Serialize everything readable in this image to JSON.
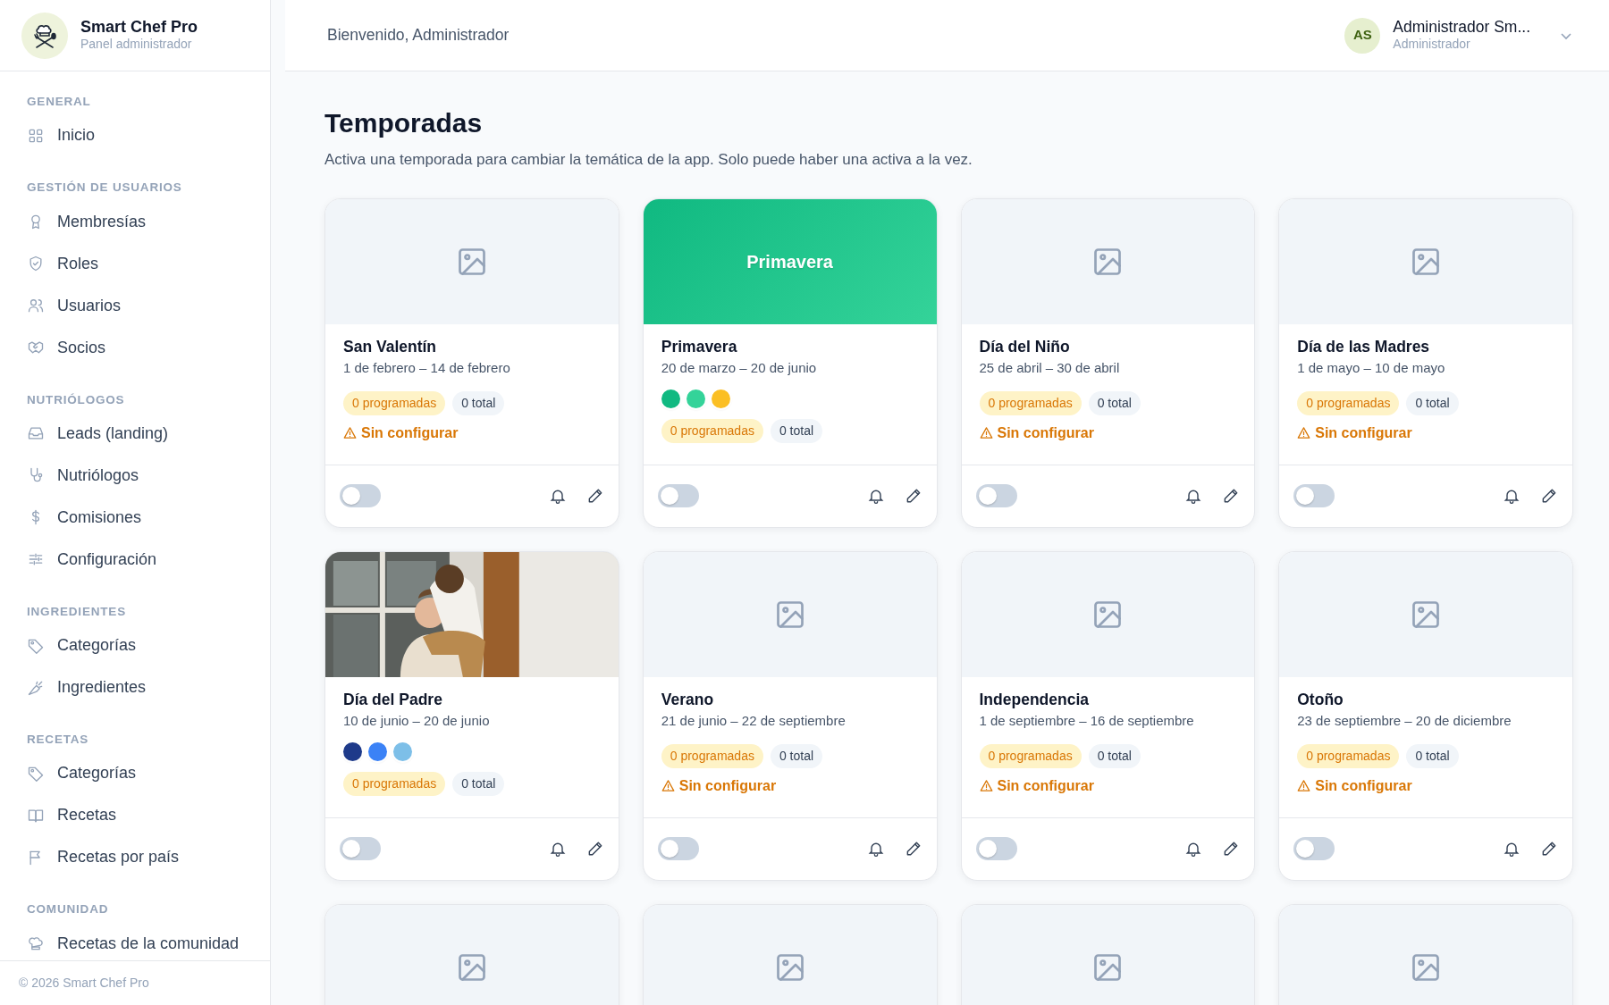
{
  "brand": {
    "title": "Smart Chef Pro",
    "subtitle": "Panel administrador"
  },
  "sidebar": {
    "sections": [
      {
        "title": "GENERAL",
        "items": [
          "Inicio"
        ]
      },
      {
        "title": "GESTIÓN DE USUARIOS",
        "items": [
          "Membresías",
          "Roles",
          "Usuarios",
          "Socios"
        ]
      },
      {
        "title": "NUTRIÓLOGOS",
        "items": [
          "Leads (landing)",
          "Nutriólogos",
          "Comisiones",
          "Configuración"
        ]
      },
      {
        "title": "INGREDIENTES",
        "items": [
          "Categorías",
          "Ingredientes"
        ]
      },
      {
        "title": "RECETAS",
        "items": [
          "Categorías",
          "Recetas",
          "Recetas por país"
        ]
      },
      {
        "title": "COMUNIDAD",
        "items": [
          "Recetas de la comunidad"
        ]
      }
    ],
    "footer": "© 2026 Smart Chef Pro"
  },
  "header": {
    "greeting": "Bienvenido, Administrador",
    "user": {
      "initials": "AS",
      "name": "Administrador Sm...",
      "role": "Administrador"
    }
  },
  "page": {
    "title": "Temporadas",
    "subtitle": "Activa una temporada para cambiar la temática de la app. Solo puede haber una activa a la vez."
  },
  "seasons": [
    {
      "kind": "placeholder",
      "title": "San Valentín",
      "dates": "1 de febrero – 14 de febrero",
      "scheduled": "0 programadas",
      "total": "0 total",
      "warning": "Sin configurar",
      "active": false
    },
    {
      "kind": "color",
      "header_label": "Primavera",
      "title": "Primavera",
      "dates": "20 de marzo – 20 de junio",
      "palette": [
        {
          "color": "#10b981"
        },
        {
          "color": "#34d399"
        },
        {
          "color": "#fbbf24"
        }
      ],
      "scheduled": "0 programadas",
      "total": "0 total",
      "active": false
    },
    {
      "kind": "placeholder",
      "title": "Día del Niño",
      "dates": "25 de abril – 30 de abril",
      "scheduled": "0 programadas",
      "total": "0 total",
      "warning": "Sin configurar",
      "active": false
    },
    {
      "kind": "placeholder",
      "title": "Día de las Madres",
      "dates": "1 de mayo – 10 de mayo",
      "scheduled": "0 programadas",
      "total": "0 total",
      "warning": "Sin configurar",
      "active": false
    },
    {
      "kind": "picture",
      "title": "Día del Padre",
      "dates": "10 de junio – 20 de junio",
      "palette": [
        {
          "color": "#1e3a8a"
        },
        {
          "color": "#3b82f6"
        },
        {
          "color": "#7dbfe8"
        }
      ],
      "scheduled": "0 programadas",
      "total": "0 total",
      "active": false
    },
    {
      "kind": "placeholder",
      "title": "Verano",
      "dates": "21 de junio – 22 de septiembre",
      "scheduled": "0 programadas",
      "total": "0 total",
      "warning": "Sin configurar",
      "active": false
    },
    {
      "kind": "placeholder",
      "title": "Independencia",
      "dates": "1 de septiembre – 16 de septiembre",
      "scheduled": "0 programadas",
      "total": "0 total",
      "warning": "Sin configurar",
      "active": false
    },
    {
      "kind": "placeholder",
      "title": "Otoño",
      "dates": "23 de septiembre – 20 de diciembre",
      "scheduled": "0 programadas",
      "total": "0 total",
      "warning": "Sin configurar",
      "active": false
    },
    {
      "kind": "placeholder"
    },
    {
      "kind": "placeholder"
    },
    {
      "kind": "placeholder"
    },
    {
      "kind": "placeholder"
    }
  ]
}
